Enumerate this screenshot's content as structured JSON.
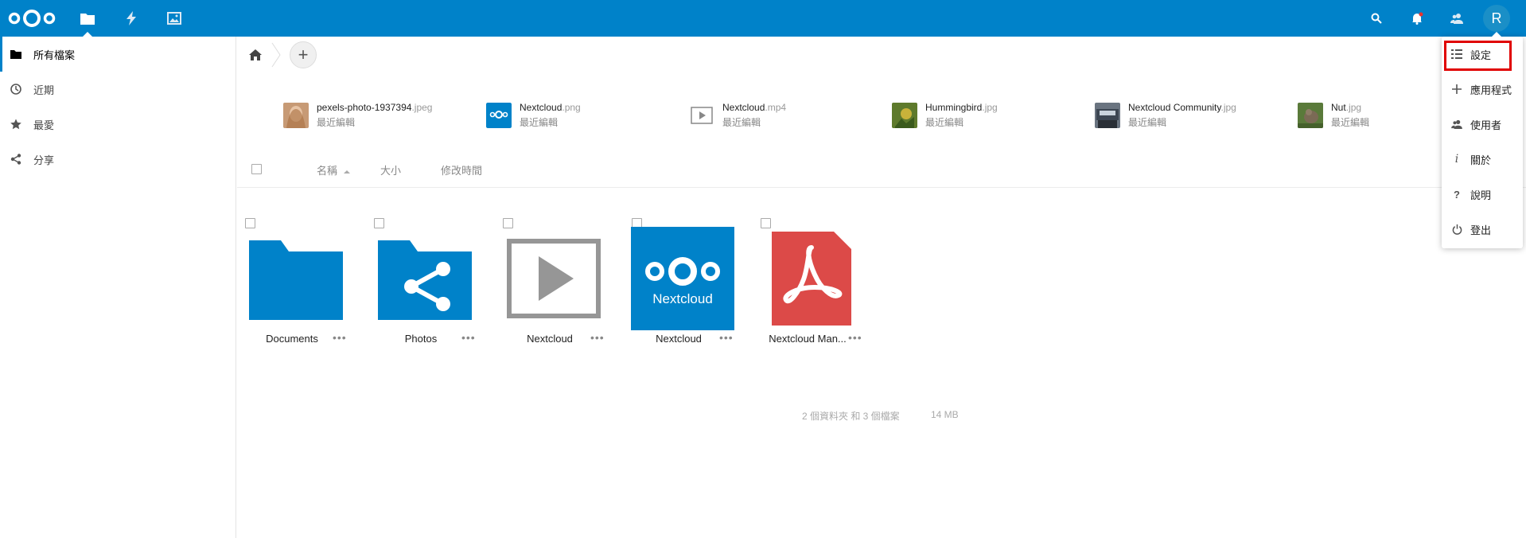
{
  "header": {
    "avatar_letter": "R",
    "accent": "#0082c9"
  },
  "sidebar": {
    "items": [
      {
        "label": "所有檔案",
        "icon": "folder-icon"
      },
      {
        "label": "近期",
        "icon": "clock-icon"
      },
      {
        "label": "最愛",
        "icon": "star-icon"
      },
      {
        "label": "分享",
        "icon": "share-icon"
      }
    ]
  },
  "recent": [
    {
      "name": "pexels-photo-1937394",
      "ext": ".jpeg",
      "sub": "最近編輯"
    },
    {
      "name": "Nextcloud",
      "ext": ".png",
      "sub": "最近編輯"
    },
    {
      "name": "Nextcloud",
      "ext": ".mp4",
      "sub": "最近編輯"
    },
    {
      "name": "Hummingbird",
      "ext": ".jpg",
      "sub": "最近編輯"
    },
    {
      "name": "Nextcloud Community",
      "ext": ".jpg",
      "sub": "最近編輯"
    },
    {
      "name": "Nut",
      "ext": ".jpg",
      "sub": "最近編輯"
    }
  ],
  "columns": {
    "name": "名稱",
    "size": "大小",
    "modified": "修改時間"
  },
  "files": [
    {
      "label": "Documents"
    },
    {
      "label": "Photos"
    },
    {
      "label": "Nextcloud"
    },
    {
      "label": "Nextcloud"
    },
    {
      "label": "Nextcloud Man..."
    }
  ],
  "summary": {
    "counts": "2 個資料夾 和 3 個檔案",
    "size": "14 MB"
  },
  "menu": [
    {
      "label": "設定",
      "icon": "settings-list-icon"
    },
    {
      "label": "應用程式",
      "icon": "plus-icon"
    },
    {
      "label": "使用者",
      "icon": "users-icon"
    },
    {
      "label": "關於",
      "icon": "info-icon"
    },
    {
      "label": "說明",
      "icon": "help-icon"
    },
    {
      "label": "登出",
      "icon": "power-icon"
    }
  ]
}
